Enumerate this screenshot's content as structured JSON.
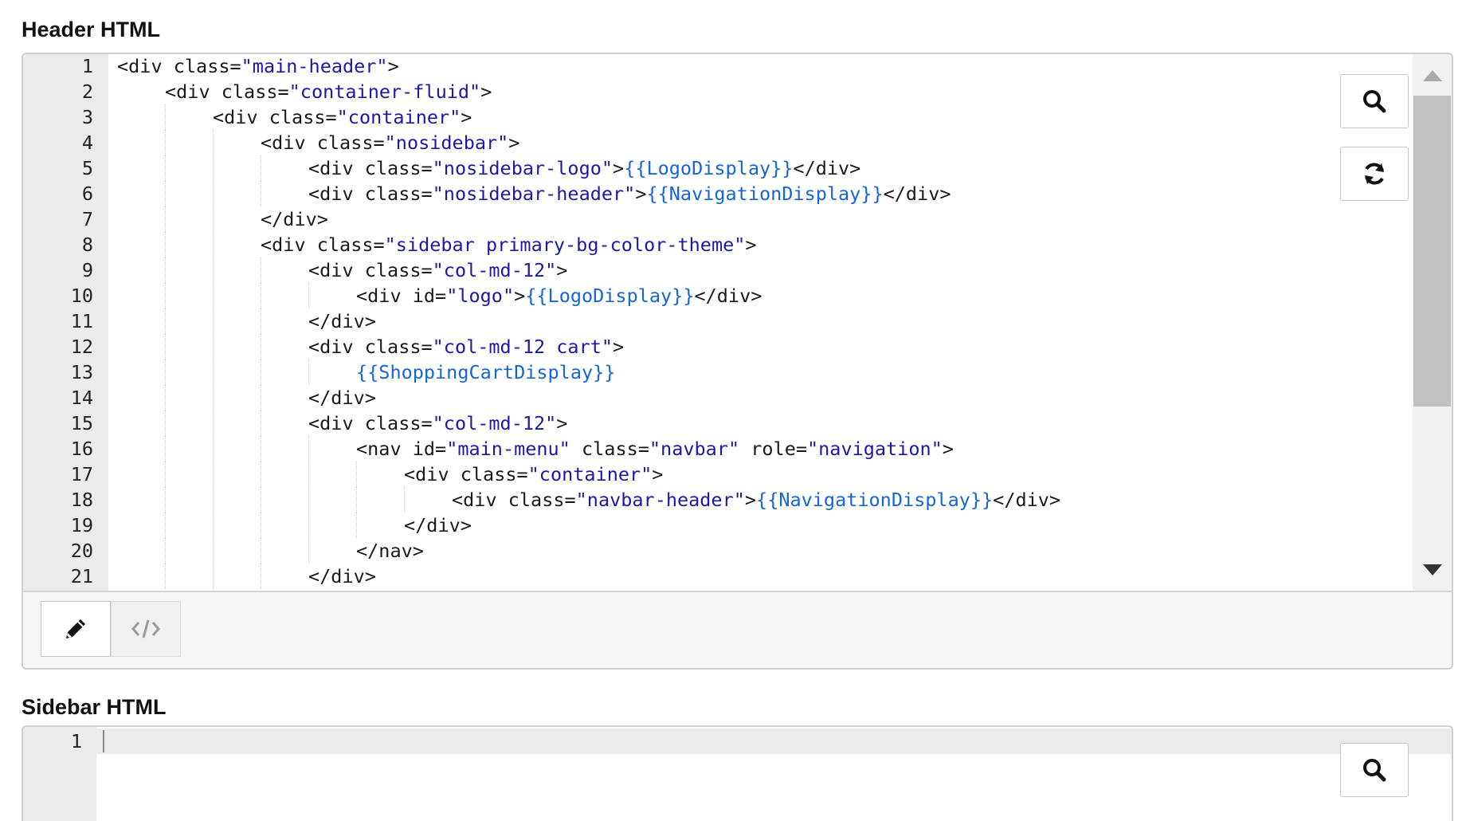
{
  "sections": {
    "header_label": "Header HTML",
    "sidebar_label": "Sidebar HTML"
  },
  "header_editor": {
    "lines": [
      {
        "n": "1",
        "indent": 0,
        "tokens": [
          [
            "p",
            "<div "
          ],
          [
            "a",
            "class"
          ],
          [
            "p",
            "="
          ],
          [
            "s",
            "\"main-header\""
          ],
          [
            "p",
            ">"
          ]
        ]
      },
      {
        "n": "2",
        "indent": 1,
        "tokens": [
          [
            "p",
            "<div "
          ],
          [
            "a",
            "class"
          ],
          [
            "p",
            "="
          ],
          [
            "s",
            "\"container-fluid\""
          ],
          [
            "p",
            ">"
          ]
        ]
      },
      {
        "n": "3",
        "indent": 2,
        "tokens": [
          [
            "p",
            "<div "
          ],
          [
            "a",
            "class"
          ],
          [
            "p",
            "="
          ],
          [
            "s",
            "\"container\""
          ],
          [
            "p",
            ">"
          ]
        ]
      },
      {
        "n": "4",
        "indent": 3,
        "tokens": [
          [
            "p",
            "<div "
          ],
          [
            "a",
            "class"
          ],
          [
            "p",
            "="
          ],
          [
            "s",
            "\"nosidebar\""
          ],
          [
            "p",
            ">"
          ]
        ]
      },
      {
        "n": "5",
        "indent": 4,
        "tokens": [
          [
            "p",
            "<div "
          ],
          [
            "a",
            "class"
          ],
          [
            "p",
            "="
          ],
          [
            "s",
            "\"nosidebar-logo\""
          ],
          [
            "p",
            ">"
          ],
          [
            "t",
            "{{LogoDisplay}}"
          ],
          [
            "p",
            "</div>"
          ]
        ]
      },
      {
        "n": "6",
        "indent": 4,
        "tokens": [
          [
            "p",
            "<div "
          ],
          [
            "a",
            "class"
          ],
          [
            "p",
            "="
          ],
          [
            "s",
            "\"nosidebar-header\""
          ],
          [
            "p",
            ">"
          ],
          [
            "t",
            "{{NavigationDisplay}}"
          ],
          [
            "p",
            "</div>"
          ]
        ]
      },
      {
        "n": "7",
        "indent": 3,
        "tokens": [
          [
            "p",
            "</div>"
          ]
        ]
      },
      {
        "n": "8",
        "indent": 3,
        "tokens": [
          [
            "p",
            "<div "
          ],
          [
            "a",
            "class"
          ],
          [
            "p",
            "="
          ],
          [
            "s",
            "\"sidebar primary-bg-color-theme\""
          ],
          [
            "p",
            ">"
          ]
        ]
      },
      {
        "n": "9",
        "indent": 4,
        "tokens": [
          [
            "p",
            "<div "
          ],
          [
            "a",
            "class"
          ],
          [
            "p",
            "="
          ],
          [
            "s",
            "\"col-md-12\""
          ],
          [
            "p",
            ">"
          ]
        ]
      },
      {
        "n": "10",
        "indent": 5,
        "tokens": [
          [
            "p",
            "<div "
          ],
          [
            "a",
            "id"
          ],
          [
            "p",
            "="
          ],
          [
            "s",
            "\"logo\""
          ],
          [
            "p",
            ">"
          ],
          [
            "t",
            "{{LogoDisplay}}"
          ],
          [
            "p",
            "</div>"
          ]
        ]
      },
      {
        "n": "11",
        "indent": 4,
        "tokens": [
          [
            "p",
            "</div>"
          ]
        ]
      },
      {
        "n": "12",
        "indent": 4,
        "tokens": [
          [
            "p",
            "<div "
          ],
          [
            "a",
            "class"
          ],
          [
            "p",
            "="
          ],
          [
            "s",
            "\"col-md-12 cart\""
          ],
          [
            "p",
            ">"
          ]
        ]
      },
      {
        "n": "13",
        "indent": 5,
        "tokens": [
          [
            "t",
            "{{ShoppingCartDisplay}}"
          ]
        ]
      },
      {
        "n": "14",
        "indent": 4,
        "tokens": [
          [
            "p",
            "</div>"
          ]
        ]
      },
      {
        "n": "15",
        "indent": 4,
        "tokens": [
          [
            "p",
            "<div "
          ],
          [
            "a",
            "class"
          ],
          [
            "p",
            "="
          ],
          [
            "s",
            "\"col-md-12\""
          ],
          [
            "p",
            ">"
          ]
        ]
      },
      {
        "n": "16",
        "indent": 5,
        "tokens": [
          [
            "p",
            "<nav "
          ],
          [
            "a",
            "id"
          ],
          [
            "p",
            "="
          ],
          [
            "s",
            "\"main-menu\""
          ],
          [
            "p",
            " "
          ],
          [
            "a",
            "class"
          ],
          [
            "p",
            "="
          ],
          [
            "s",
            "\"navbar\""
          ],
          [
            "p",
            " "
          ],
          [
            "a",
            "role"
          ],
          [
            "p",
            "="
          ],
          [
            "s",
            "\"navigation\""
          ],
          [
            "p",
            ">"
          ]
        ]
      },
      {
        "n": "17",
        "indent": 6,
        "tokens": [
          [
            "p",
            "<div "
          ],
          [
            "a",
            "class"
          ],
          [
            "p",
            "="
          ],
          [
            "s",
            "\"container\""
          ],
          [
            "p",
            ">"
          ]
        ]
      },
      {
        "n": "18",
        "indent": 7,
        "tokens": [
          [
            "p",
            "<div "
          ],
          [
            "a",
            "class"
          ],
          [
            "p",
            "="
          ],
          [
            "s",
            "\"navbar-header\""
          ],
          [
            "p",
            ">"
          ],
          [
            "t",
            "{{NavigationDisplay}}"
          ],
          [
            "p",
            "</div>"
          ]
        ]
      },
      {
        "n": "19",
        "indent": 6,
        "tokens": [
          [
            "p",
            "</div>"
          ]
        ]
      },
      {
        "n": "20",
        "indent": 5,
        "tokens": [
          [
            "p",
            "</nav>"
          ]
        ]
      },
      {
        "n": "21",
        "indent": 4,
        "tokens": [
          [
            "p",
            "</div>"
          ]
        ]
      }
    ],
    "buttons": {
      "search_icon": "magnifier-icon",
      "refresh_icon": "refresh-icon"
    },
    "toolbar": {
      "edit_icon": "pencil-icon",
      "code_icon": "code-icon"
    }
  },
  "sidebar_editor": {
    "lines": [
      {
        "n": "1",
        "indent": 0,
        "tokens": []
      }
    ],
    "buttons": {
      "search_icon": "magnifier-icon"
    }
  },
  "colors": {
    "attr_value": "#1a1aa6",
    "template_var": "#1466d6",
    "gutter_bg": "#ebebeb",
    "toolbar_bg": "#f5f5f5",
    "scroll_thumb": "#c1c1c1"
  }
}
